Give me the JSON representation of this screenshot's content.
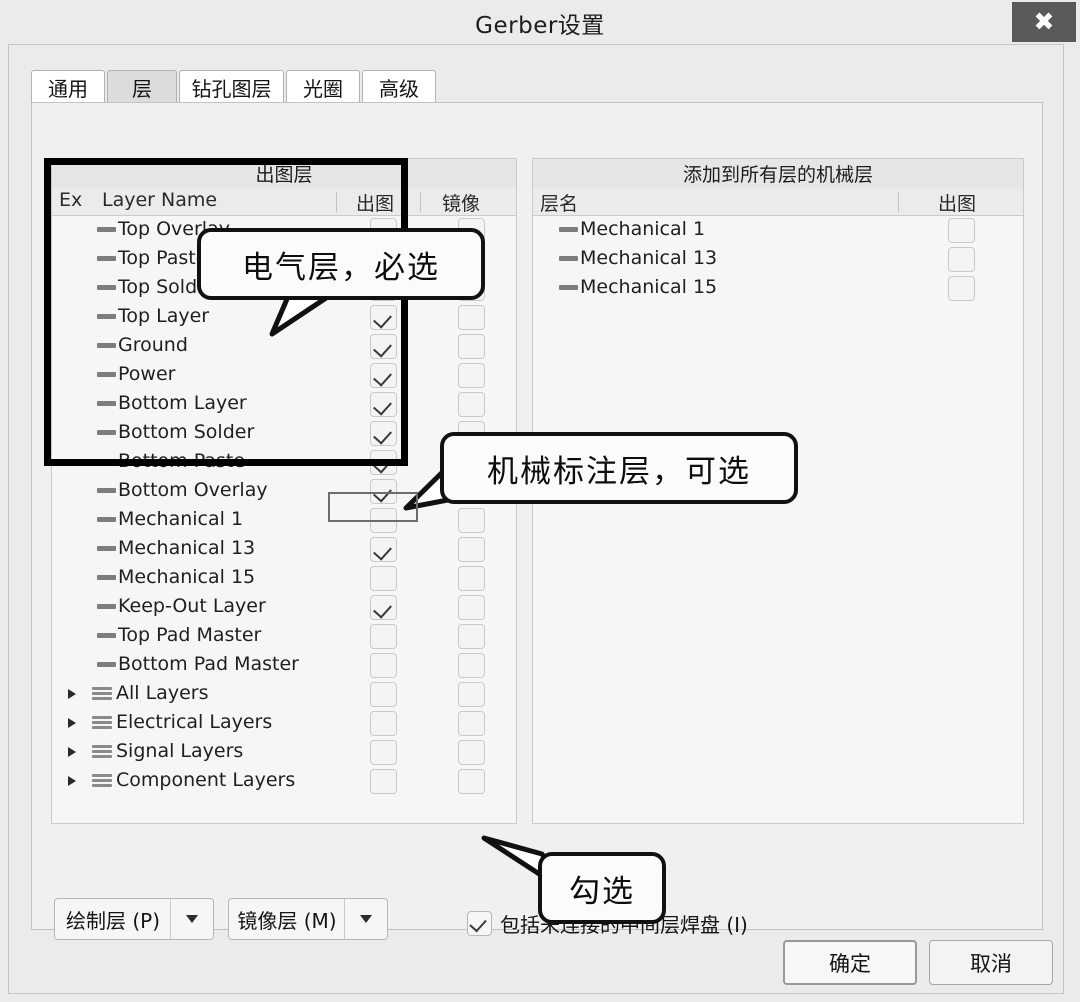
{
  "window": {
    "title": "Gerber设置",
    "close_icon": "close-icon"
  },
  "tabs": [
    {
      "label": "通用",
      "active": false
    },
    {
      "label": "层",
      "active": true
    },
    {
      "label": "钻孔图层",
      "active": false
    },
    {
      "label": "光圈",
      "active": false
    },
    {
      "label": "高级",
      "active": false
    }
  ],
  "plot_layers_panel": {
    "caption": "出图层",
    "columns": [
      "Ex",
      "Layer Name",
      "出图",
      "镜像"
    ],
    "rows": [
      {
        "name": "Top Overlay",
        "icon": "layer-dash-icon",
        "expandable": false,
        "plot": true,
        "mirror": false
      },
      {
        "name": "Top Paste",
        "icon": "layer-dash-icon",
        "expandable": false,
        "plot": true,
        "mirror": false
      },
      {
        "name": "Top Solder",
        "icon": "layer-dash-icon",
        "expandable": false,
        "plot": true,
        "mirror": false
      },
      {
        "name": "Top Layer",
        "icon": "layer-dash-icon",
        "expandable": false,
        "plot": true,
        "mirror": false
      },
      {
        "name": "Ground",
        "icon": "layer-dash-icon",
        "expandable": false,
        "plot": true,
        "mirror": false
      },
      {
        "name": "Power",
        "icon": "layer-dash-icon",
        "expandable": false,
        "plot": true,
        "mirror": false
      },
      {
        "name": "Bottom Layer",
        "icon": "layer-dash-icon",
        "expandable": false,
        "plot": true,
        "mirror": false
      },
      {
        "name": "Bottom Solder",
        "icon": "layer-dash-icon",
        "expandable": false,
        "plot": true,
        "mirror": false
      },
      {
        "name": "Bottom Paste",
        "icon": "layer-dash-icon",
        "expandable": false,
        "plot": true,
        "mirror": false
      },
      {
        "name": "Bottom Overlay",
        "icon": "layer-dash-icon",
        "expandable": false,
        "plot": true,
        "mirror": false
      },
      {
        "name": "Mechanical 1",
        "icon": "layer-dash-icon",
        "expandable": false,
        "plot": false,
        "mirror": false
      },
      {
        "name": "Mechanical 13",
        "icon": "layer-dash-icon",
        "expandable": false,
        "plot": true,
        "mirror": false
      },
      {
        "name": "Mechanical 15",
        "icon": "layer-dash-icon",
        "expandable": false,
        "plot": false,
        "mirror": false
      },
      {
        "name": "Keep-Out Layer",
        "icon": "layer-dash-icon",
        "expandable": false,
        "plot": true,
        "mirror": false
      },
      {
        "name": "Top Pad Master",
        "icon": "layer-dash-icon",
        "expandable": false,
        "plot": false,
        "mirror": false
      },
      {
        "name": "Bottom Pad Master",
        "icon": "layer-dash-icon",
        "expandable": false,
        "plot": false,
        "mirror": false
      },
      {
        "name": "All Layers",
        "icon": "layer-stack-icon",
        "expandable": true,
        "plot": false,
        "mirror": false
      },
      {
        "name": "Electrical Layers",
        "icon": "layer-stack-icon",
        "expandable": true,
        "plot": false,
        "mirror": false
      },
      {
        "name": "Signal Layers",
        "icon": "layer-stack-icon",
        "expandable": true,
        "plot": false,
        "mirror": false
      },
      {
        "name": "Component Layers",
        "icon": "layer-stack-icon",
        "expandable": true,
        "plot": false,
        "mirror": false
      }
    ]
  },
  "mechanical_panel": {
    "caption": "添加到所有层的机械层",
    "columns": [
      "层名",
      "出图"
    ],
    "rows": [
      {
        "name": "Mechanical 1",
        "icon": "layer-dash-icon",
        "plot": false
      },
      {
        "name": "Mechanical 13",
        "icon": "layer-dash-icon",
        "plot": false
      },
      {
        "name": "Mechanical 15",
        "icon": "layer-dash-icon",
        "plot": false
      }
    ]
  },
  "bottom_controls": {
    "plot_layers_button": "绘制层 (P)",
    "mirror_layers_button": "镜像层 (M)",
    "include_pads_checkbox": {
      "label": "包括未连接的中间层焊盘 (I)",
      "checked": true
    }
  },
  "footer": {
    "ok_label": "确定",
    "cancel_label": "取消"
  },
  "annotations": [
    {
      "id": "electrical",
      "text": "电气层，必选"
    },
    {
      "id": "mechanical",
      "text": "机械标注层，可选"
    },
    {
      "id": "check",
      "text": "勾选"
    }
  ],
  "colors": {
    "dialog_bg": "#eceaea",
    "panel_bg": "#f7f6f6",
    "close_button": "#5a5a5a",
    "annotation_stroke": "#111111",
    "active_tab": "#dedbdb"
  }
}
